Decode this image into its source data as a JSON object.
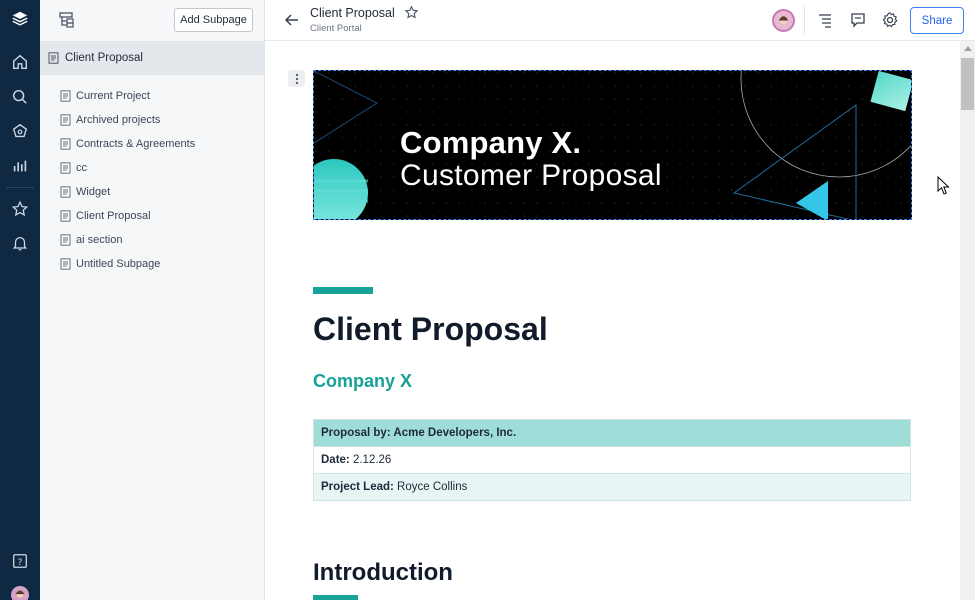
{
  "rail": {
    "icons": [
      "logo-icon",
      "home-icon",
      "search-icon",
      "spaces-icon",
      "analytics-icon",
      "star-icon",
      "bell-icon",
      "help-icon",
      "avatar"
    ]
  },
  "sidebar": {
    "add_subpage_label": "Add Subpage",
    "active_page": "Client Proposal",
    "items": [
      {
        "label": "Current Project"
      },
      {
        "label": "Archived projects"
      },
      {
        "label": "Contracts & Agreements"
      },
      {
        "label": "cc"
      },
      {
        "label": "Widget"
      },
      {
        "label": "Client Proposal"
      },
      {
        "label": "ai section"
      },
      {
        "label": "Untitled Subpage"
      }
    ]
  },
  "header": {
    "title": "Client Proposal",
    "subtitle": "Client Portal",
    "share_label": "Share"
  },
  "banner": {
    "line1": "Company X.",
    "line2": "Customer Proposal"
  },
  "document": {
    "title": "Client Proposal",
    "subtitle": "Company X",
    "table": {
      "proposal_by_label": "Proposal by: Acme Developers, Inc.",
      "date_label": "Date:",
      "date_value": " 2.12.26",
      "lead_label": "Project Lead:",
      "lead_value": " Royce Collins"
    },
    "section_heading": "Introduction"
  },
  "colors": {
    "rail": "#0f2942",
    "accent": "#17a39a",
    "table_header": "#9fded8",
    "share": "#2563eb"
  }
}
